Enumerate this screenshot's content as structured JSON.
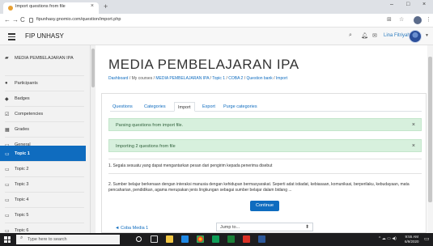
{
  "browser": {
    "tab_title": "Import questions from file",
    "tab_close": "×",
    "new_tab": "+",
    "url": "fipunhasy.gnomio.com/question/import.php",
    "window_controls": [
      "–",
      "□",
      "×"
    ],
    "nav": {
      "back": "←",
      "forward": "→",
      "reload": "C"
    }
  },
  "navbar": {
    "site_name": "FIP UNHASY",
    "user_name": "Lina Fitriyah",
    "icons": [
      "search-icon",
      "bell-icon",
      "chat-icon"
    ]
  },
  "drawer": {
    "items": [
      {
        "label": "MEDIA PEMBELAJARAN IPA",
        "icon": "graduation-cap-icon",
        "glyph": "🎓"
      },
      {
        "label": "Participants",
        "icon": "users-icon",
        "glyph": "👥"
      },
      {
        "label": "Badges",
        "icon": "shield-icon",
        "glyph": "⛉"
      },
      {
        "label": "Competencies",
        "icon": "check-box-icon",
        "glyph": "☑"
      },
      {
        "label": "Grades",
        "icon": "table-icon",
        "glyph": "▦"
      },
      {
        "label": "General",
        "icon": "folder-icon",
        "glyph": "▭"
      },
      {
        "label": "Topic 1",
        "icon": "folder-icon",
        "glyph": "▭",
        "active": true
      },
      {
        "label": "Topic 2",
        "icon": "folder-icon",
        "glyph": "▭"
      },
      {
        "label": "Topic 3",
        "icon": "folder-icon",
        "glyph": "▭"
      },
      {
        "label": "Topic 4",
        "icon": "folder-icon",
        "glyph": "▭"
      },
      {
        "label": "Topic 5",
        "icon": "folder-icon",
        "glyph": "▭"
      },
      {
        "label": "Topic 6",
        "icon": "folder-icon",
        "glyph": "▭"
      }
    ]
  },
  "main": {
    "course_title": "MEDIA PEMBELAJARAN IPA",
    "breadcrumb": [
      "Dashboard",
      "My courses",
      "MEDIA PEMBELAJARAN IPA",
      "Topic 1",
      "COBA 2",
      "Question bank",
      "Import"
    ],
    "breadcrumb_sep": "/",
    "tabs": [
      "Questions",
      "Categories",
      "Import",
      "Export",
      "Purge categories"
    ],
    "active_tab": "Import",
    "alerts": [
      "Parsing questions from import file.",
      "Importing 2 questions from file"
    ],
    "alert_close": "×",
    "questions": [
      "1. Segala sesuatu yang dapat mengantarkan pesan dari  pengirim kepada penerima disebut",
      "2. Sumber belajar berkenaan dengan interaksi manusia dengan kehidupan bermasyarakat. Seperti adat istiadat, kebiasaan, komunikasi, berperilaku, kebudayaan, mata pencaharian, pendidikan, agama merupakan jenis lingkungan sebagai sumber belajar dalam bidang ..."
    ],
    "continue_label": "Continue",
    "prev_activity": "◄ Coba Media 1",
    "jump_to": "Jump to...",
    "jump_caret": "⬍"
  },
  "taskbar": {
    "search_placeholder": "Type here to search",
    "clock_time": "9:55 AM",
    "clock_date": "6/9/2020",
    "app_colors": [
      "#ffffff",
      "#f2c744",
      "#1e88e5",
      "#34a853",
      "#fbbc05",
      "#0f9d58",
      "#d93025",
      "#2b579a"
    ]
  },
  "colors": {
    "accent": "#0f6cbf",
    "alert_bg": "#d7f0dd",
    "taskbar": "#1d1d1f"
  }
}
